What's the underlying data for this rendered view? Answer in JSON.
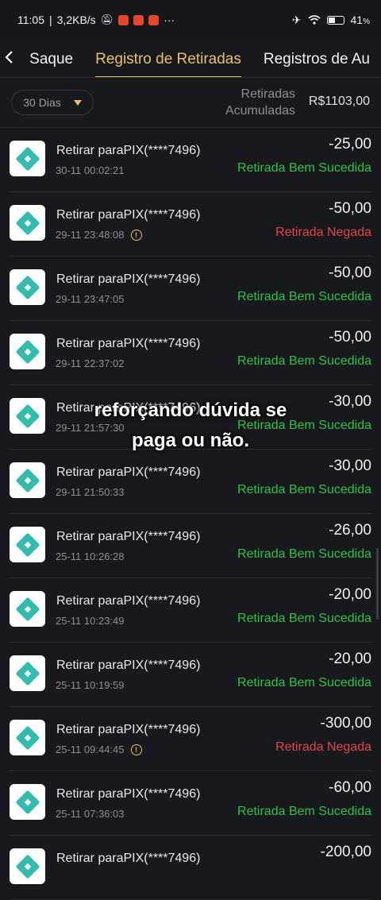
{
  "status_bar": {
    "time": "11:05",
    "speed": "3,2KB/s",
    "battery": "41",
    "battery_fill": 0.41,
    "icons": [
      "bell-off-icon",
      "app-notification-icon",
      "app-notification-icon",
      "app-notification-icon",
      "more-icon",
      "airplane-icon",
      "wifi-icon",
      "battery-icon"
    ]
  },
  "nav": {
    "back_icon": "chevron-left-icon",
    "tabs": [
      "Saque",
      "Registro de Retiradas",
      "Registros de Au"
    ],
    "active_tab": 1
  },
  "filter": {
    "period": "30 Dias",
    "accumulated_label_line1": "Retiradas",
    "accumulated_label_line2": "Acumuladas",
    "accumulated_value": "R$1103,00"
  },
  "overlay_text": {
    "line1": "reforçando dúvida se",
    "line2": "paga ou não."
  },
  "withdrawals": [
    {
      "title": "Retirar paraPIX(****7496)",
      "timestamp": "30-11 00:02:21",
      "amount": "-25,00",
      "status": "Retirada Bem Sucedida",
      "state": "ok",
      "info": false
    },
    {
      "title": "Retirar paraPIX(****7496)",
      "timestamp": "29-11 23:48:08",
      "amount": "-50,00",
      "status": "Retirada Negada",
      "state": "neg",
      "info": true
    },
    {
      "title": "Retirar paraPIX(****7496)",
      "timestamp": "29-11 23:47:05",
      "amount": "-50,00",
      "status": "Retirada Bem Sucedida",
      "state": "ok",
      "info": false
    },
    {
      "title": "Retirar paraPIX(****7496)",
      "timestamp": "29-11 22:37:02",
      "amount": "-50,00",
      "status": "Retirada Bem Sucedida",
      "state": "ok",
      "info": false
    },
    {
      "title": "Retirar paraPIX(****7496)",
      "timestamp": "29-11 21:57:30",
      "amount": "-30,00",
      "status": "Retirada Bem Sucedida",
      "state": "ok",
      "info": false
    },
    {
      "title": "Retirar paraPIX(****7496)",
      "timestamp": "29-11 21:50:33",
      "amount": "-30,00",
      "status": "Retirada Bem Sucedida",
      "state": "ok",
      "info": false
    },
    {
      "title": "Retirar paraPIX(****7496)",
      "timestamp": "25-11 10:26:28",
      "amount": "-26,00",
      "status": "Retirada Bem Sucedida",
      "state": "ok",
      "info": false
    },
    {
      "title": "Retirar paraPIX(****7496)",
      "timestamp": "25-11 10:23:49",
      "amount": "-20,00",
      "status": "Retirada Bem Sucedida",
      "state": "ok",
      "info": false
    },
    {
      "title": "Retirar paraPIX(****7496)",
      "timestamp": "25-11 10:19:59",
      "amount": "-20,00",
      "status": "Retirada Bem Sucedida",
      "state": "ok",
      "info": false
    },
    {
      "title": "Retirar paraPIX(****7496)",
      "timestamp": "25-11 09:44:45",
      "amount": "-300,00",
      "status": "Retirada Negada",
      "state": "neg",
      "info": true
    },
    {
      "title": "Retirar paraPIX(****7496)",
      "timestamp": "25-11 07:36:03",
      "amount": "-60,00",
      "status": "Retirada Bem Sucedida",
      "state": "ok",
      "info": false
    },
    {
      "title": "Retirar paraPIX(****7496)",
      "timestamp": "",
      "amount": "-200,00",
      "status": "",
      "state": "ok",
      "info": false
    }
  ],
  "colors": {
    "background": "#18191d",
    "accent": "#e7c168",
    "success": "#2ec24c",
    "denied": "#e2454a",
    "pix_logo": "#32bcad"
  }
}
